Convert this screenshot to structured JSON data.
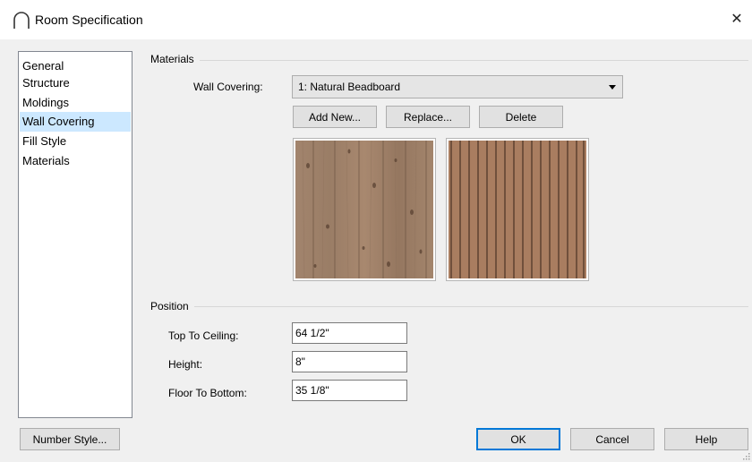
{
  "window": {
    "title": "Room Specification",
    "close_glyph": "✕"
  },
  "sidebar": {
    "items": [
      {
        "label": "General"
      },
      {
        "label": "Structure"
      },
      {
        "label": "Moldings"
      },
      {
        "label": "Wall Covering",
        "selected": true
      },
      {
        "label": "Fill Style"
      },
      {
        "label": "Materials"
      }
    ]
  },
  "materials": {
    "group_label": "Materials",
    "wall_covering_label": "Wall Covering:",
    "wall_covering_value": "1:  Natural Beadboard",
    "add_new_label": "Add New...",
    "replace_label": "Replace...",
    "delete_label": "Delete",
    "texture_icon": "wood-texture-swatch",
    "pattern_icon": "beadboard-pattern-swatch",
    "colors": {
      "wood": "#a0816a",
      "pattern": "#a97d60",
      "pattern_lines": "#4b3224"
    }
  },
  "position": {
    "group_label": "Position",
    "top_to_ceiling_label": "Top To Ceiling:",
    "top_to_ceiling_value": "64 1/2\"",
    "height_label": "Height:",
    "height_value": "8\"",
    "floor_to_bottom_label": "Floor To Bottom:",
    "floor_to_bottom_value": "35 1/8\""
  },
  "footer": {
    "number_style_label": "Number Style...",
    "ok_label": "OK",
    "cancel_label": "Cancel",
    "help_label": "Help"
  },
  "colors": {
    "selection": "#cce8ff",
    "default_button_border": "#0078d7",
    "dialog_bg": "#f0f0f0"
  }
}
